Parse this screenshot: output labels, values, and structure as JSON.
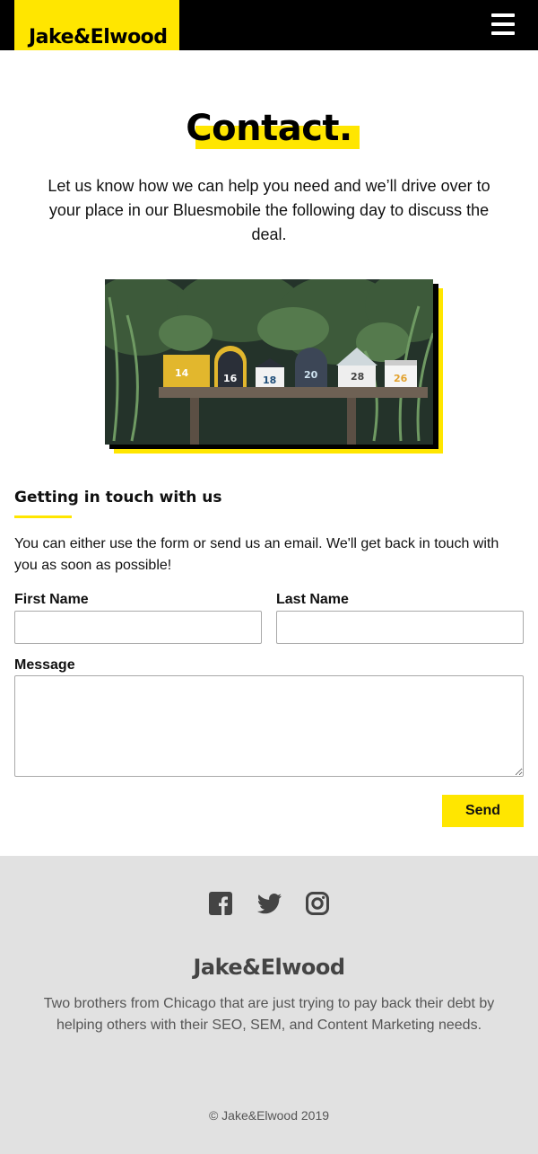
{
  "header": {
    "logo": "Jake&Elwood",
    "menu_icon": "hamburger-menu-icon"
  },
  "hero": {
    "title": "Contact.",
    "intro": "Let us know how we can help you need and we’ll drive over to your place in our Bluesmobile the following day to discuss the deal."
  },
  "image": {
    "numbers": [
      "14",
      "16",
      "18",
      "20",
      "28",
      "26"
    ]
  },
  "section": {
    "title": "Getting in touch with us",
    "text": "You can either use the form or send us an email. We'll get back in touch with you as soon as possible!"
  },
  "form": {
    "first_name_label": "First Name",
    "first_name_value": "",
    "last_name_label": "Last Name",
    "last_name_value": "",
    "message_label": "Message",
    "message_value": "",
    "send_label": "Send"
  },
  "footer": {
    "social": [
      "facebook-icon",
      "twitter-icon",
      "instagram-icon"
    ],
    "logo": "Jake&Elwood",
    "text": "Two brothers from Chicago that are just trying to pay back their debt by helping others with their SEO, SEM, and Content Marketing needs.",
    "copyright": "© Jake&Elwood 2019"
  },
  "colors": {
    "accent": "#FFE600",
    "header_bg": "#000000",
    "footer_bg": "#E1E1E1"
  }
}
